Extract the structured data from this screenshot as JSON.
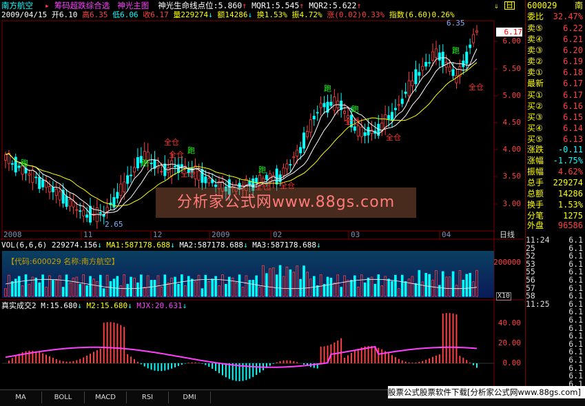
{
  "stock": {
    "name": "南方航空",
    "code": "600029",
    "short_name": "南"
  },
  "title_bar": {
    "formula_label": "筹码超跌综合选",
    "formula2": "神光主图",
    "line_label": "神光生命线点位:5.860",
    "mqr1": "MQR1:5.545",
    "mqr2": "MQR2:5.622"
  },
  "info": {
    "date": "2009/04/15",
    "open": "开6.10",
    "high": "高6.35",
    "low": "低6.06",
    "close": "收6.17",
    "vol": "量229274",
    "amount": "额14286",
    "turnover": "换1.53%",
    "amplitude": "振4.72%",
    "change": "涨(0.02)0.33%",
    "index": "指数(6.60)0.26%"
  },
  "price_axis": [
    "6.00",
    "5.50",
    "5.00",
    "4.50",
    "4.00",
    "3.50",
    "3.00"
  ],
  "price_marks": {
    "high": "6.35",
    "low": "2.65",
    "current": "6.17"
  },
  "signals": {
    "run": "跑",
    "full": "全仓"
  },
  "date_axis": [
    "2008",
    "11",
    "12",
    "2009",
    "02",
    "03",
    "04"
  ],
  "date_axis_right": "日线",
  "vol_panel": {
    "header": "VOL(6,6,6)",
    "val": "229274.156",
    "ma1": "MA1:587178.688",
    "ma2": "MA2:587178.688",
    "ma3": "MA3:587178.688",
    "code_label": "【代码:600029 名称:南方航空】",
    "axis": [
      "200000"
    ],
    "unit": "X10"
  },
  "ind_panel": {
    "header": "真实成交2",
    "m": "M:15.680",
    "m2": "M2:15.680",
    "mjx": "MJX:20.631",
    "axis": [
      "40.00",
      "20.00",
      "0.00"
    ]
  },
  "right_panel": {
    "code": "600029",
    "name": "南",
    "ratio_label": "委比",
    "ratio_val": "32.47%",
    "sells": [
      {
        "l": "卖⑤",
        "v": "6.22"
      },
      {
        "l": "卖④",
        "v": "6.21"
      },
      {
        "l": "卖③",
        "v": "6.20"
      },
      {
        "l": "卖②",
        "v": "6.19"
      },
      {
        "l": "卖①",
        "v": "6.18"
      }
    ],
    "latest_label": "最新",
    "latest_val": "6.17",
    "buys": [
      {
        "l": "买①",
        "v": "6.17"
      },
      {
        "l": "买②",
        "v": "6.16"
      },
      {
        "l": "买③",
        "v": "6.15"
      },
      {
        "l": "买④",
        "v": "6.14"
      },
      {
        "l": "买⑤",
        "v": "6.13"
      }
    ],
    "stats": [
      {
        "l": "涨跌",
        "v": "-0.11"
      },
      {
        "l": "涨幅",
        "v": "-1.75%"
      },
      {
        "l": "振幅",
        "v": "4.62%"
      },
      {
        "l": "总手",
        "v": "229274"
      },
      {
        "l": "总额",
        "v": "14286"
      },
      {
        "l": "换手",
        "v": "1.53%"
      },
      {
        "l": "分笔",
        "v": "1275"
      }
    ],
    "outer_label": "外盘",
    "outer_val": "96586",
    "ticks": [
      {
        "t": "11:24",
        "p": "6.1"
      },
      {
        "t": "25",
        "p": "6.1"
      },
      {
        "t": "52",
        "p": "6.1"
      },
      {
        "t": "53",
        "p": "6.1"
      },
      {
        "t": "55",
        "p": "6.1"
      },
      {
        "t": "56",
        "p": "6.1"
      },
      {
        "t": "57",
        "p": "6.1"
      },
      {
        "t": "58",
        "p": "6.1"
      },
      {
        "t": "11:25",
        "p": "6.1"
      },
      {
        "t": "",
        "p": "6.1"
      },
      {
        "t": "",
        "p": "6.1"
      },
      {
        "t": "",
        "p": "6.1"
      },
      {
        "t": "",
        "p": "6.1"
      },
      {
        "t": "",
        "p": "6.1"
      },
      {
        "t": "",
        "p": "6.1"
      },
      {
        "t": "",
        "p": "6.1"
      },
      {
        "t": "",
        "p": "6.1"
      },
      {
        "t": "",
        "p": "6.1"
      },
      {
        "t": "",
        "p": "6.1"
      }
    ]
  },
  "tabs": [
    "MA",
    "BOLL",
    "MACD",
    "RSI",
    "DMI"
  ],
  "watermark": "分析家公式网www.88gs.com",
  "ad_banner": "股票公式股票软件下载[分析家公式网www.88gs.com]",
  "colors": {
    "up": "#ff4040",
    "down": "#00ffff",
    "ma1": "#ffffff",
    "ma2": "#ffff00",
    "ma3": "#ff40ff"
  }
}
